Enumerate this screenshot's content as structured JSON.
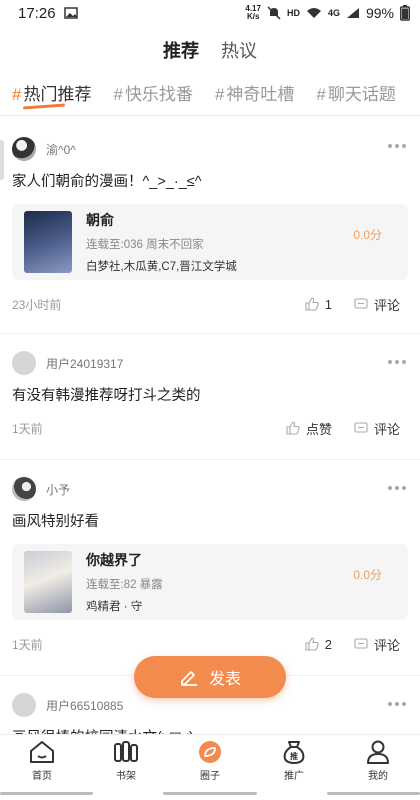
{
  "status": {
    "time": "17:26",
    "speed_top": "4.17",
    "speed_bottom": "K/s",
    "hd": "HD",
    "net": "4G",
    "battery": "99%"
  },
  "top_tabs": [
    {
      "label": "推荐",
      "active": true
    },
    {
      "label": "热议",
      "active": false
    }
  ],
  "topics": [
    "热门推荐",
    "快乐找番",
    "神奇吐槽",
    "聊天话题"
  ],
  "posts": [
    {
      "user": "渝^0^",
      "text": "家人们朝俞的漫画！^_>_·_≤^",
      "card": {
        "title": "朝俞",
        "sub": "连载至:036 周末不回家",
        "tags": "白梦社,木瓜黄,C7,晋江文学城",
        "score": "0.0分"
      },
      "time": "23小时前",
      "likes": "1",
      "comment": "评论"
    },
    {
      "user": "用户24019317",
      "text": "有没有韩漫推荐呀打斗之类的",
      "time": "1天前",
      "likes": "点赞",
      "comment": "评论"
    },
    {
      "user": "小予",
      "text": "画风特别好看",
      "card": {
        "title": "你越界了",
        "sub": "连载至:82 暴露",
        "tags": "鸡精君 · 守",
        "score": "0.0分"
      },
      "time": "1天前",
      "likes": "2",
      "comment": "评论"
    },
    {
      "user": "用户66510885",
      "text": "画风很棒的校园清水文(≥▽≤)"
    }
  ],
  "publish_label": "发表",
  "nav": [
    {
      "label": "首页",
      "icon": "home-icon"
    },
    {
      "label": "书架",
      "icon": "bookshelf-icon"
    },
    {
      "label": "圈子",
      "icon": "circle-icon",
      "active": true
    },
    {
      "label": "推广",
      "icon": "promote-icon"
    },
    {
      "label": "我的",
      "icon": "profile-icon"
    }
  ],
  "colors": {
    "accent": "#f37a3c",
    "score": "#f0a05a"
  }
}
